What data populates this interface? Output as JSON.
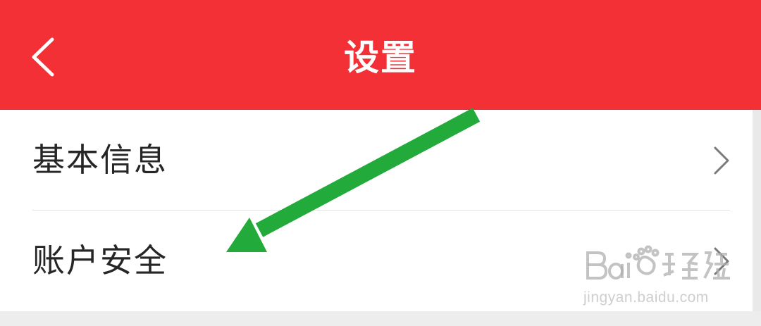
{
  "header": {
    "title": "设置",
    "back_icon": "chevron-left-icon",
    "background_color": "#F23036"
  },
  "list": {
    "items": [
      {
        "label": "基本信息",
        "icon": "chevron-right-icon"
      },
      {
        "label": "账户安全",
        "icon": "chevron-right-icon"
      }
    ]
  },
  "annotation": {
    "icon": "green-arrow-icon",
    "color": "#22AA3A"
  },
  "watermark": {
    "logo_text": "Bai经验",
    "url": "jingyan.baidu.com"
  }
}
